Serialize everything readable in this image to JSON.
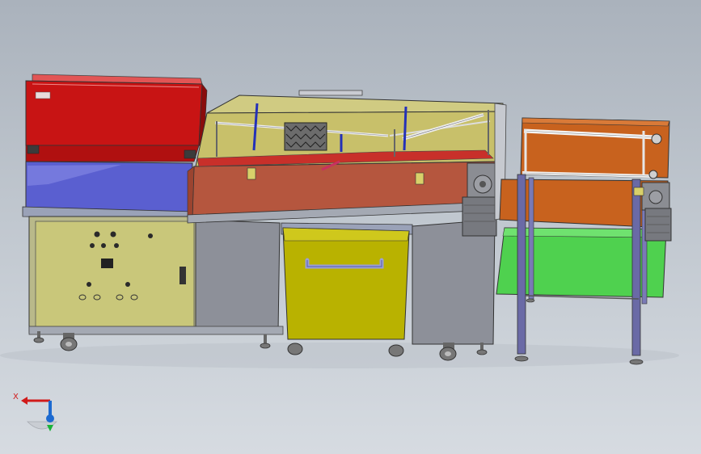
{
  "colors": {
    "background_top": "#aab2bc",
    "background_bottom": "#d6dbe1",
    "red_housing": "#c81414",
    "blue_tray": "#5a5fd0",
    "olive_cabinet": "#c9c77a",
    "tank_olive": "#c8c06a",
    "tank_wall": "#b5563e",
    "bin_yellow": "#b9b200",
    "grey_panel": "#8d9099",
    "orange_guard": "#c8621e",
    "green_tray": "#4fd14f",
    "frame_purple": "#6a6aa6",
    "motor_grey": "#77797f",
    "axis_x_color": "#d11a1a",
    "axis_y_color": "#1c6ad0",
    "axis_z_color": "#18b238"
  },
  "triad": {
    "x_label": "X"
  }
}
